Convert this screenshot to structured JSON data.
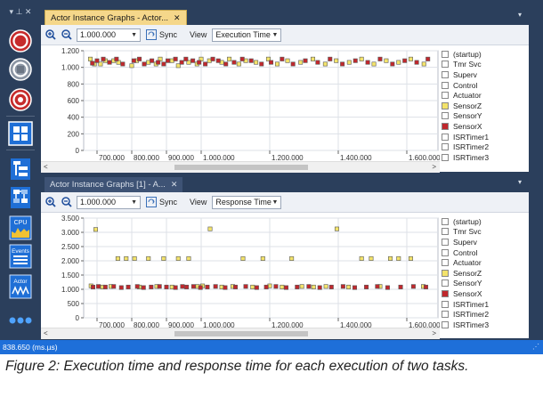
{
  "toolbar": {
    "pin_glyph": "▾ ⊥ ✕",
    "buttons": [
      {
        "name": "record-button",
        "icon": "record-icon"
      },
      {
        "name": "stop-button",
        "icon": "stop-icon"
      },
      {
        "name": "snapshot-button",
        "icon": "target-icon"
      },
      {
        "name": "layout-grid-button",
        "icon": "grid-icon"
      },
      {
        "name": "tree-view-button",
        "icon": "tree-icon"
      },
      {
        "name": "flow-view-button",
        "icon": "flow-icon"
      },
      {
        "name": "cpu-load-button",
        "icon": "cpu-icon",
        "label": "CPU"
      },
      {
        "name": "events-button",
        "icon": "events-icon",
        "label": "Events"
      },
      {
        "name": "actor-button",
        "icon": "actor-icon",
        "label": "Actor"
      },
      {
        "name": "more-button",
        "icon": "more-icon"
      }
    ]
  },
  "panels": [
    {
      "tab_label": "Actor Instance Graphs - Actor...",
      "tab_style": "active",
      "zoom_value": "1.000.000",
      "sync_label": "Sync",
      "view_label": "View",
      "view_value": "Execution Time",
      "legend": [
        {
          "label": "(startup)",
          "color": "#ffffff"
        },
        {
          "label": "Tmr Svc",
          "color": "#ffffff"
        },
        {
          "label": "Superv",
          "color": "#ffffff"
        },
        {
          "label": "Control",
          "color": "#ffffff"
        },
        {
          "label": "Actuator",
          "color": "#ffffff"
        },
        {
          "label": "SensorZ",
          "color": "#f3e36b"
        },
        {
          "label": "SensorY",
          "color": "#ffffff"
        },
        {
          "label": "SensorX",
          "color": "#c0282d"
        },
        {
          "label": "ISRTimer1",
          "color": "#ffffff"
        },
        {
          "label": "ISRTimer2",
          "color": "#ffffff"
        },
        {
          "label": "ISRTimer3",
          "color": "#ffffff"
        }
      ],
      "chart_data": {
        "type": "scatter",
        "y_ticks": [
          "1.200",
          "1.000",
          "800",
          "600",
          "400",
          "200",
          "0"
        ],
        "ylim": [
          0,
          1200
        ],
        "x_ticks": [
          "700.000",
          "800.000",
          "900.000",
          "1.000.000",
          "1.200.000",
          "1.400.000",
          "1.600.000"
        ],
        "series": [
          {
            "name": "SensorZ",
            "color": "#f3e36b",
            "points": [
              [
                680000,
                1100
              ],
              [
                692000,
                1040
              ],
              [
                710000,
                1040
              ],
              [
                724000,
                1080
              ],
              [
                748000,
                1080
              ],
              [
                762000,
                1060
              ],
              [
                800000,
                1020
              ],
              [
                814000,
                1080
              ],
              [
                848000,
                1060
              ],
              [
                870000,
                1040
              ],
              [
                882000,
                1100
              ],
              [
                916000,
                1080
              ],
              [
                934000,
                1020
              ],
              [
                964000,
                1060
              ],
              [
                988000,
                1040
              ],
              [
                1000000,
                1100
              ],
              [
                1024000,
                1080
              ],
              [
                1060000,
                1060
              ],
              [
                1082000,
                1100
              ],
              [
                1110000,
                1040
              ],
              [
                1130000,
                1080
              ],
              [
                1160000,
                1060
              ],
              [
                1196000,
                1100
              ],
              [
                1222000,
                1040
              ],
              [
                1252000,
                1080
              ],
              [
                1290000,
                1060
              ],
              [
                1326000,
                1100
              ],
              [
                1362000,
                1040
              ],
              [
                1394000,
                1080
              ],
              [
                1432000,
                1060
              ],
              [
                1468000,
                1100
              ],
              [
                1504000,
                1040
              ],
              [
                1540000,
                1080
              ],
              [
                1576000,
                1060
              ],
              [
                1612000,
                1100
              ],
              [
                1652000,
                1040
              ]
            ]
          },
          {
            "name": "SensorX",
            "color": "#c0282d",
            "points": [
              [
                686000,
                1050
              ],
              [
                700000,
                1080
              ],
              [
                718000,
                1100
              ],
              [
                736000,
                1060
              ],
              [
                756000,
                1100
              ],
              [
                774000,
                1040
              ],
              [
                806000,
                1080
              ],
              [
                822000,
                1100
              ],
              [
                836000,
                1040
              ],
              [
                858000,
                1080
              ],
              [
                876000,
                1060
              ],
              [
                892000,
                1040
              ],
              [
                904000,
                1080
              ],
              [
                926000,
                1100
              ],
              [
                944000,
                1060
              ],
              [
                956000,
                1100
              ],
              [
                976000,
                1080
              ],
              [
                994000,
                1060
              ],
              [
                1012000,
                1040
              ],
              [
                1034000,
                1100
              ],
              [
                1050000,
                1080
              ],
              [
                1072000,
                1040
              ],
              [
                1096000,
                1060
              ],
              [
                1120000,
                1100
              ],
              [
                1146000,
                1080
              ],
              [
                1176000,
                1040
              ],
              [
                1204000,
                1060
              ],
              [
                1236000,
                1100
              ],
              [
                1268000,
                1040
              ],
              [
                1304000,
                1080
              ],
              [
                1340000,
                1060
              ],
              [
                1376000,
                1100
              ],
              [
                1412000,
                1040
              ],
              [
                1450000,
                1080
              ],
              [
                1486000,
                1060
              ],
              [
                1522000,
                1100
              ],
              [
                1558000,
                1040
              ],
              [
                1594000,
                1080
              ],
              [
                1630000,
                1060
              ],
              [
                1664000,
                1100
              ]
            ]
          }
        ]
      }
    },
    {
      "tab_label": "Actor Instance Graphs [1] - A...",
      "tab_style": "inactive",
      "zoom_value": "1.000.000",
      "sync_label": "Sync",
      "view_label": "View",
      "view_value": "Response Time",
      "legend": [
        {
          "label": "(startup)",
          "color": "#ffffff"
        },
        {
          "label": "Tmr Svc",
          "color": "#ffffff"
        },
        {
          "label": "Superv",
          "color": "#ffffff"
        },
        {
          "label": "Control",
          "color": "#ffffff"
        },
        {
          "label": "Actuator",
          "color": "#ffffff"
        },
        {
          "label": "SensorZ",
          "color": "#f3e36b"
        },
        {
          "label": "SensorY",
          "color": "#ffffff"
        },
        {
          "label": "SensorX",
          "color": "#c0282d"
        },
        {
          "label": "ISRTimer1",
          "color": "#ffffff"
        },
        {
          "label": "ISRTimer2",
          "color": "#ffffff"
        },
        {
          "label": "ISRTimer3",
          "color": "#ffffff"
        }
      ],
      "chart_data": {
        "type": "scatter",
        "y_ticks": [
          "3.500",
          "3.000",
          "2.500",
          "2.000",
          "1.500",
          "1.000",
          "500",
          "0"
        ],
        "ylim": [
          0,
          3500
        ],
        "x_ticks": [
          "700.000",
          "800.000",
          "900.000",
          "1.000.000",
          "1.200.000",
          "1.400.000",
          "1.600.000"
        ],
        "series": [
          {
            "name": "SensorZ",
            "color": "#f3e36b",
            "points": [
              [
                682000,
                1120
              ],
              [
                696000,
                3100
              ],
              [
                716000,
                1080
              ],
              [
                740000,
                1100
              ],
              [
                760000,
                2080
              ],
              [
                784000,
                2080
              ],
              [
                808000,
                2080
              ],
              [
                822000,
                1080
              ],
              [
                848000,
                2080
              ],
              [
                872000,
                1100
              ],
              [
                892000,
                2080
              ],
              [
                916000,
                1080
              ],
              [
                934000,
                2080
              ],
              [
                964000,
                2080
              ],
              [
                990000,
                1100
              ],
              [
                1004000,
                1120
              ],
              [
                1026000,
                3120
              ],
              [
                1060000,
                1080
              ],
              [
                1092000,
                1100
              ],
              [
                1122000,
                2080
              ],
              [
                1150000,
                1080
              ],
              [
                1180000,
                2080
              ],
              [
                1200000,
                1120
              ],
              [
                1236000,
                1080
              ],
              [
                1264000,
                2080
              ],
              [
                1294000,
                1100
              ],
              [
                1328000,
                1080
              ],
              [
                1364000,
                1100
              ],
              [
                1396000,
                3120
              ],
              [
                1430000,
                1080
              ],
              [
                1468000,
                2080
              ],
              [
                1496000,
                2080
              ],
              [
                1522000,
                1100
              ],
              [
                1552000,
                2080
              ],
              [
                1576000,
                2080
              ],
              [
                1612000,
                2080
              ],
              [
                1650000,
                1100
              ]
            ]
          },
          {
            "name": "SensorX",
            "color": "#c0282d",
            "points": [
              [
                688000,
                1080
              ],
              [
                704000,
                1100
              ],
              [
                724000,
                1080
              ],
              [
                748000,
                1100
              ],
              [
                770000,
                1060
              ],
              [
                790000,
                1080
              ],
              [
                816000,
                1100
              ],
              [
                834000,
                1060
              ],
              [
                856000,
                1080
              ],
              [
                880000,
                1100
              ],
              [
                900000,
                1080
              ],
              [
                926000,
                1060
              ],
              [
                946000,
                1100
              ],
              [
                958000,
                1080
              ],
              [
                978000,
                1100
              ],
              [
                998000,
                1060
              ],
              [
                1018000,
                1080
              ],
              [
                1042000,
                1100
              ],
              [
                1070000,
                1060
              ],
              [
                1100000,
                1080
              ],
              [
                1130000,
                1100
              ],
              [
                1162000,
                1060
              ],
              [
                1190000,
                1080
              ],
              [
                1218000,
                1100
              ],
              [
                1248000,
                1060
              ],
              [
                1280000,
                1080
              ],
              [
                1314000,
                1100
              ],
              [
                1346000,
                1060
              ],
              [
                1380000,
                1080
              ],
              [
                1414000,
                1100
              ],
              [
                1448000,
                1060
              ],
              [
                1482000,
                1080
              ],
              [
                1514000,
                1100
              ],
              [
                1544000,
                1060
              ],
              [
                1582000,
                1080
              ],
              [
                1620000,
                1100
              ],
              [
                1658000,
                1080
              ]
            ]
          }
        ]
      }
    }
  ],
  "status": {
    "text": "838.650 (ms.µs)"
  },
  "caption": "Figure 2: Execution time and response time for each execution of two tasks."
}
